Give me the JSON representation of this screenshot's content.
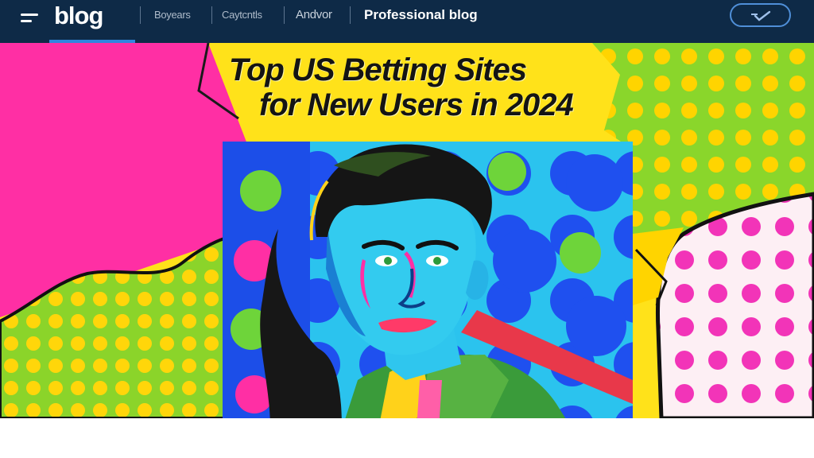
{
  "header": {
    "logo": "blog",
    "nav_links": [
      "Boyears",
      "Caytcntls",
      "Andvor"
    ],
    "title": "Professional blog",
    "menu_icon": "hamburger-icon",
    "action_icon": "checkmark-icon"
  },
  "hero": {
    "headline_line1": "Top US Betting Sites",
    "headline_line2": "for New Users in 2024"
  },
  "colors": {
    "nav_bg": "#0e2a47",
    "nav_accent": "#2f86df",
    "pop_magenta": "#ff2fa4",
    "pop_yellow": "#ffd800",
    "pop_green": "#82d630",
    "pop_blue": "#1f57f0",
    "pop_cyan": "#2cc6ef"
  }
}
